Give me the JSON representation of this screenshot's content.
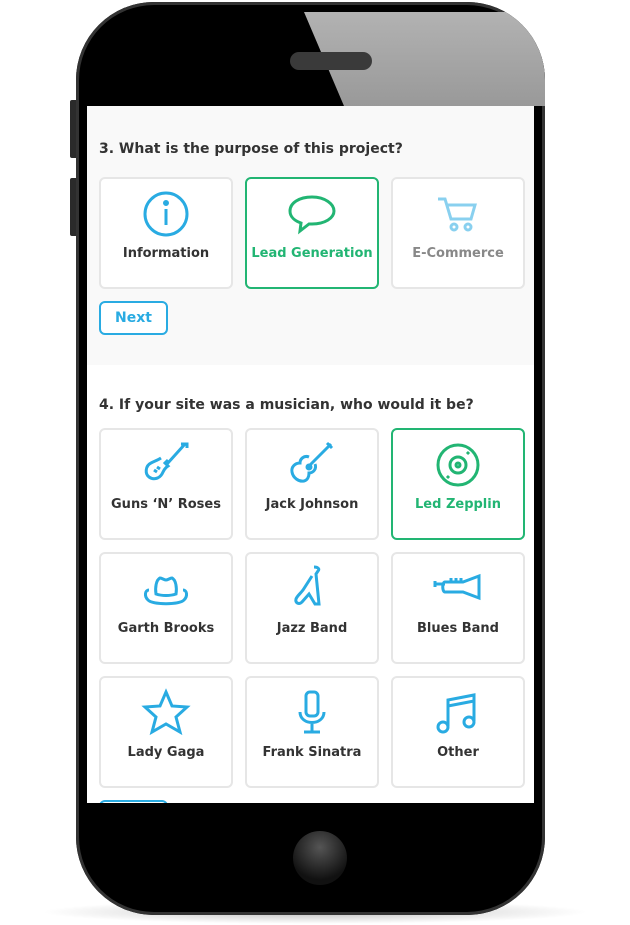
{
  "question3": {
    "title": "3. What is the purpose of this project?",
    "options": [
      {
        "label": "Information",
        "icon": "info-icon"
      },
      {
        "label": "Lead Generation",
        "icon": "speech-bubble-icon",
        "selected": true
      },
      {
        "label": "E-Commerce",
        "icon": "cart-icon"
      }
    ],
    "next_label": "Next"
  },
  "question4": {
    "title": "4. If your site was a musician, who would it be?",
    "options": [
      {
        "label": "Guns ‘N’ Roses",
        "icon": "electric-guitar-icon"
      },
      {
        "label": "Jack Johnson",
        "icon": "acoustic-guitar-icon"
      },
      {
        "label": "Led Zepplin",
        "icon": "vinyl-record-icon",
        "selected": true
      },
      {
        "label": "Garth Brooks",
        "icon": "cowboy-hat-icon"
      },
      {
        "label": "Jazz Band",
        "icon": "saxophone-icon"
      },
      {
        "label": "Blues Band",
        "icon": "trumpet-icon"
      },
      {
        "label": "Lady Gaga",
        "icon": "star-icon"
      },
      {
        "label": "Frank Sinatra",
        "icon": "microphone-icon"
      },
      {
        "label": "Other",
        "icon": "music-note-icon"
      }
    ]
  },
  "colors": {
    "accent": "#29abe2",
    "selected": "#22b573"
  }
}
